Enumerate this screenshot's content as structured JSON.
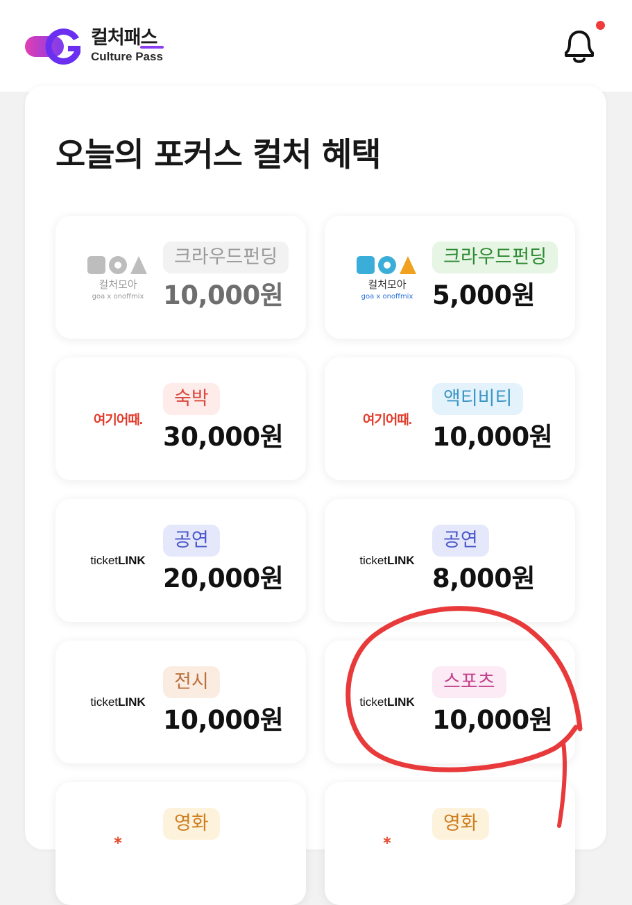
{
  "header": {
    "logo_ko": "컬처패스",
    "logo_en": "Culture Pass",
    "bell_icon": "bell-icon",
    "accent_color": "#8a3df2",
    "notification_dot_color": "#ef3b3b"
  },
  "section": {
    "title": "오늘의 포커스 컬처 혜택"
  },
  "brands": {
    "moa_mark": "MOA",
    "moa_text": "컬처모아",
    "moa_sub": "goa x onoffmix",
    "yeogi": "여기어때.",
    "ticket_prefix": "ticket",
    "ticket_suffix": "LINK"
  },
  "cards": [
    {
      "brand": "moa",
      "category": "크라우드펀딩",
      "amount": "10,000원",
      "state": "disabled",
      "tag_bg": "#f2f2f2",
      "tag_fg": "#9a9a9a"
    },
    {
      "brand": "moa",
      "category": "크라우드펀딩",
      "amount": "5,000원",
      "state": "active",
      "tag_bg": "#e6f5e4",
      "tag_fg": "#2f8a34"
    },
    {
      "brand": "yeogi",
      "category": "숙박",
      "amount": "30,000원",
      "state": "active",
      "tag_bg": "#fdecea",
      "tag_fg": "#d9463a"
    },
    {
      "brand": "yeogi",
      "category": "액티비티",
      "amount": "10,000원",
      "state": "active",
      "tag_bg": "#e4f3fb",
      "tag_fg": "#3b95c7"
    },
    {
      "brand": "ticketlink",
      "category": "공연",
      "amount": "20,000원",
      "state": "active",
      "tag_bg": "#e5e8fb",
      "tag_fg": "#4a57c9"
    },
    {
      "brand": "ticketlink",
      "category": "공연",
      "amount": "8,000원",
      "state": "active",
      "tag_bg": "#e5e8fb",
      "tag_fg": "#4a57c9"
    },
    {
      "brand": "ticketlink",
      "category": "전시",
      "amount": "10,000원",
      "state": "active",
      "tag_bg": "#fbece2",
      "tag_fg": "#b9713f"
    },
    {
      "brand": "ticketlink",
      "category": "스포츠",
      "amount": "10,000원",
      "state": "active",
      "tag_bg": "#fcebf4",
      "tag_fg": "#c2418c"
    },
    {
      "brand": "star",
      "category": "영화",
      "amount": "",
      "state": "active",
      "tag_bg": "#fdf3dd",
      "tag_fg": "#cf7d1f"
    },
    {
      "brand": "star",
      "category": "영화",
      "amount": "",
      "state": "active",
      "tag_bg": "#fdf3dd",
      "tag_fg": "#cf7d1f"
    }
  ],
  "annotation_color": "#e83a3a"
}
